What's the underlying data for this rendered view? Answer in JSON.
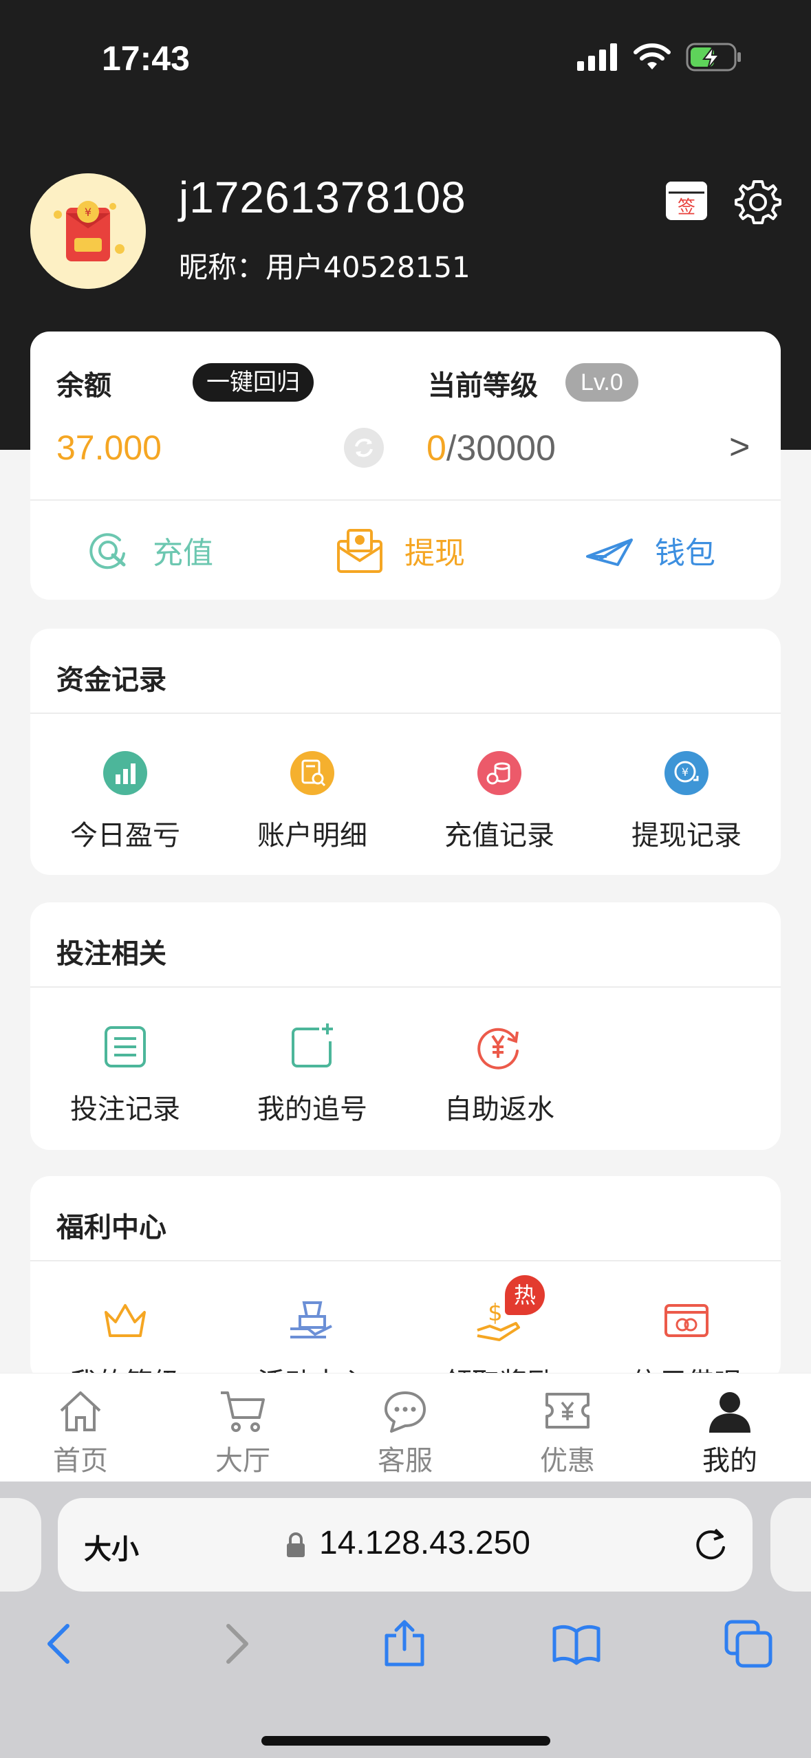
{
  "status_bar": {
    "time": "17:43"
  },
  "profile": {
    "username": "j17261378108",
    "nickname": "昵称：用户40528151",
    "sign_label": "签"
  },
  "balance": {
    "label": "余额",
    "recall_button": "一键回归",
    "value": "37.000",
    "level_label": "当前等级",
    "level_badge": "Lv.0",
    "level_current": "0",
    "level_total": "/30000",
    "arrow": ">"
  },
  "actions": [
    {
      "label": "充值",
      "color": "#6cc7b0"
    },
    {
      "label": "提现",
      "color": "#f5a623"
    },
    {
      "label": "钱包",
      "color": "#3d8fe0"
    }
  ],
  "fund_section": {
    "title": "资金记录",
    "items": [
      {
        "label": "今日盈亏",
        "icon": "chart-icon",
        "color": "#4cb69a"
      },
      {
        "label": "账户明细",
        "icon": "document-search-icon",
        "color": "#f5b02e"
      },
      {
        "label": "充值记录",
        "icon": "coins-icon",
        "color": "#ec5a6a"
      },
      {
        "label": "提现记录",
        "icon": "yuan-exchange-icon",
        "color": "#3d95d6"
      }
    ]
  },
  "bet_section": {
    "title": "投注相关",
    "items": [
      {
        "label": "投注记录",
        "icon": "list-icon",
        "color": "#4cb69a"
      },
      {
        "label": "我的追号",
        "icon": "add-square-icon",
        "color": "#4cb69a"
      },
      {
        "label": "自助返水",
        "icon": "yuan-refund-icon",
        "color": "#ec5a4a"
      }
    ]
  },
  "welfare_section": {
    "title": "福利中心",
    "items": [
      {
        "label": "我的等级",
        "icon": "crown-icon",
        "color": "#f5a623"
      },
      {
        "label": "活动中心",
        "icon": "gift-hand-icon",
        "color": "#6b8fd6"
      },
      {
        "label": "领取奖励",
        "icon": "dollar-hand-icon",
        "color": "#f5a623",
        "badge": "热"
      },
      {
        "label": "信用借呗",
        "icon": "card-icon",
        "color": "#ec5a4a"
      }
    ]
  },
  "tabbar": [
    {
      "label": "首页",
      "icon": "home-icon",
      "active": false
    },
    {
      "label": "大厅",
      "icon": "cart-icon",
      "active": false
    },
    {
      "label": "客服",
      "icon": "chat-icon",
      "active": false
    },
    {
      "label": "优惠",
      "icon": "ticket-icon",
      "active": false
    },
    {
      "label": "我的",
      "icon": "user-icon",
      "active": true
    }
  ],
  "browser": {
    "size_label": "大小",
    "url": "14.128.43.250"
  }
}
